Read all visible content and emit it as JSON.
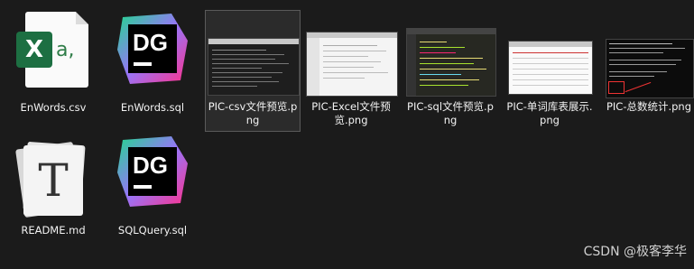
{
  "files": [
    {
      "name": "EnWords.csv",
      "type": "csv",
      "icon": "excel-csv-icon"
    },
    {
      "name": "EnWords.sql",
      "type": "sql",
      "icon": "datagrip-icon"
    },
    {
      "name": "PIC-csv文件预览.png",
      "type": "png",
      "icon": "image-thumbnail",
      "selected": true
    },
    {
      "name": "PIC-Excel文件预览.png",
      "type": "png",
      "icon": "image-thumbnail"
    },
    {
      "name": "PIC-sql文件预览.png",
      "type": "png",
      "icon": "image-thumbnail"
    },
    {
      "name": "PIC-单词库表展示.png",
      "type": "png",
      "icon": "image-thumbnail"
    },
    {
      "name": "PIC-总数统计.png",
      "type": "png",
      "icon": "image-thumbnail"
    },
    {
      "name": "README.md",
      "type": "md",
      "icon": "typora-icon"
    },
    {
      "name": "SQLQuery.sql",
      "type": "sql",
      "icon": "datagrip-icon"
    }
  ],
  "icons": {
    "csv_badge_letter": "X",
    "csv_ext_text": "a,",
    "datagrip_letters": "DG",
    "typora_letter": "T"
  },
  "colors": {
    "background": "#1b1b1b",
    "selection": "#2b2b2b",
    "excel_green": "#1d6f42"
  },
  "watermark": "CSDN @极客李华"
}
